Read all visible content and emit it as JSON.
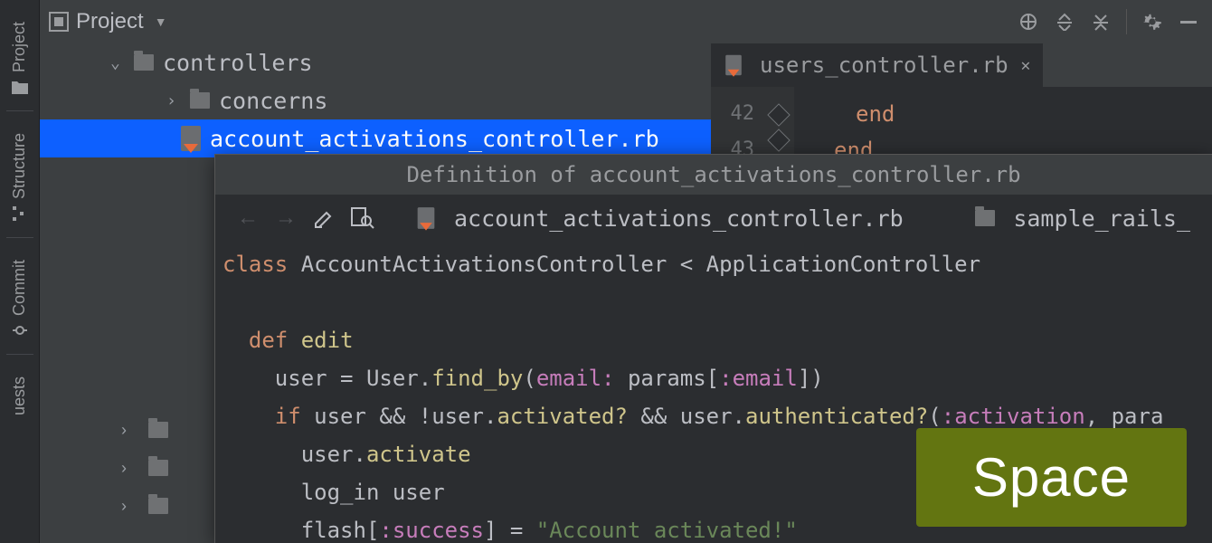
{
  "leftRail": {
    "items": [
      {
        "label": "Project",
        "iconName": "folder-icon"
      },
      {
        "label": "Structure",
        "iconName": "structure-icon"
      },
      {
        "label": "Commit",
        "iconName": "commit-icon"
      },
      {
        "label": "uests",
        "iconName": "requests-icon"
      }
    ]
  },
  "projectPanel": {
    "title": "Project",
    "items": [
      {
        "label": "controllers",
        "type": "folder",
        "expanded": true,
        "indent": 1
      },
      {
        "label": "concerns",
        "type": "folder",
        "expanded": false,
        "indent": 2
      },
      {
        "label": "account_activations_controller.rb",
        "type": "ruby",
        "selected": true,
        "indent": 2
      }
    ]
  },
  "editor": {
    "tab": "users_controller.rb",
    "gutterStart": 42,
    "lines": [
      {
        "text": "end",
        "indent": 3
      },
      {
        "text": "end",
        "indent": 2
      },
      {
        "text": "",
        "indent": 0
      }
    ]
  },
  "quickDef": {
    "titlePrefix": "Definition of ",
    "titleFile": "account_activations_controller.rb",
    "filename": "account_activations_controller.rb",
    "projectPath": "sample_rails_",
    "code": {
      "l1_class": "class",
      "l1_name": " AccountActivationsController ",
      "l1_lt": "<",
      "l1_super": " ApplicationController",
      "l3_def": "def",
      "l3_name": " edit",
      "l4": "    user = ",
      "l4_User": "User",
      "l4_rest1": ".",
      "l4_findby": "find_by",
      "l4_paren": "(",
      "l4_email": "email: ",
      "l4_params": "params",
      "l4_br1": "[",
      "l4_sym": ":email",
      "l4_br2": "])",
      "l5_if": "if",
      "l5_a": " user && !user.",
      "l5_act": "activated?",
      "l5_b": " && user.",
      "l5_auth": "authenticated?",
      "l5_c": "(",
      "l5_sym1": ":activation",
      "l5_d": ", para",
      "l6": "      user.",
      "l6_m": "activate",
      "l7": "      log_in user",
      "l8a": "      flash[",
      "l8_sym": ":success",
      "l8b": "] = ",
      "l8_str": "\"Account activated!\""
    }
  },
  "keyOverlay": {
    "label": "Space"
  }
}
